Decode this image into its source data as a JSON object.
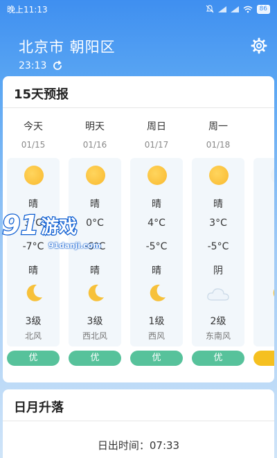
{
  "status_bar": {
    "time": "晚上11:13",
    "battery": "86"
  },
  "header": {
    "location": "北京市 朝阳区",
    "update_time": "23:13"
  },
  "forecast": {
    "title": "15天预报",
    "days": [
      {
        "name": "今天",
        "date": "01/15",
        "day_weather": "晴",
        "high": "3°C",
        "low": "-7°C",
        "night_weather": "晴",
        "night_icon": "moon-icon",
        "wind_level": "3级",
        "wind_dir": "北风",
        "aqi": "优"
      },
      {
        "name": "明天",
        "date": "01/16",
        "day_weather": "晴",
        "high": "0°C",
        "low": "-6°C",
        "night_weather": "晴",
        "night_icon": "moon-icon",
        "wind_level": "3级",
        "wind_dir": "西北风",
        "aqi": "优"
      },
      {
        "name": "周日",
        "date": "01/17",
        "day_weather": "晴",
        "high": "4°C",
        "low": "-5°C",
        "night_weather": "晴",
        "night_icon": "moon-icon",
        "wind_level": "1级",
        "wind_dir": "西风",
        "aqi": "优"
      },
      {
        "name": "周一",
        "date": "01/18",
        "day_weather": "晴",
        "high": "3°C",
        "low": "-5°C",
        "night_weather": "阴",
        "night_icon": "cloud-icon",
        "wind_level": "2级",
        "wind_dir": "东南风",
        "aqi": "优"
      },
      {
        "name": "周",
        "date": "01",
        "high": "-",
        "low": "-",
        "wind_level": "1",
        "wind_dir": "东"
      }
    ]
  },
  "sun_moon": {
    "title": "日月升落",
    "sunrise": "日出时间：07:33"
  },
  "watermark": {
    "logo": "91游戏",
    "site": "91danji.com"
  },
  "colors": {
    "aqi_good": "#57c29b",
    "aqi_moderate": "#f5c020",
    "accent": "#3f8ff0"
  }
}
